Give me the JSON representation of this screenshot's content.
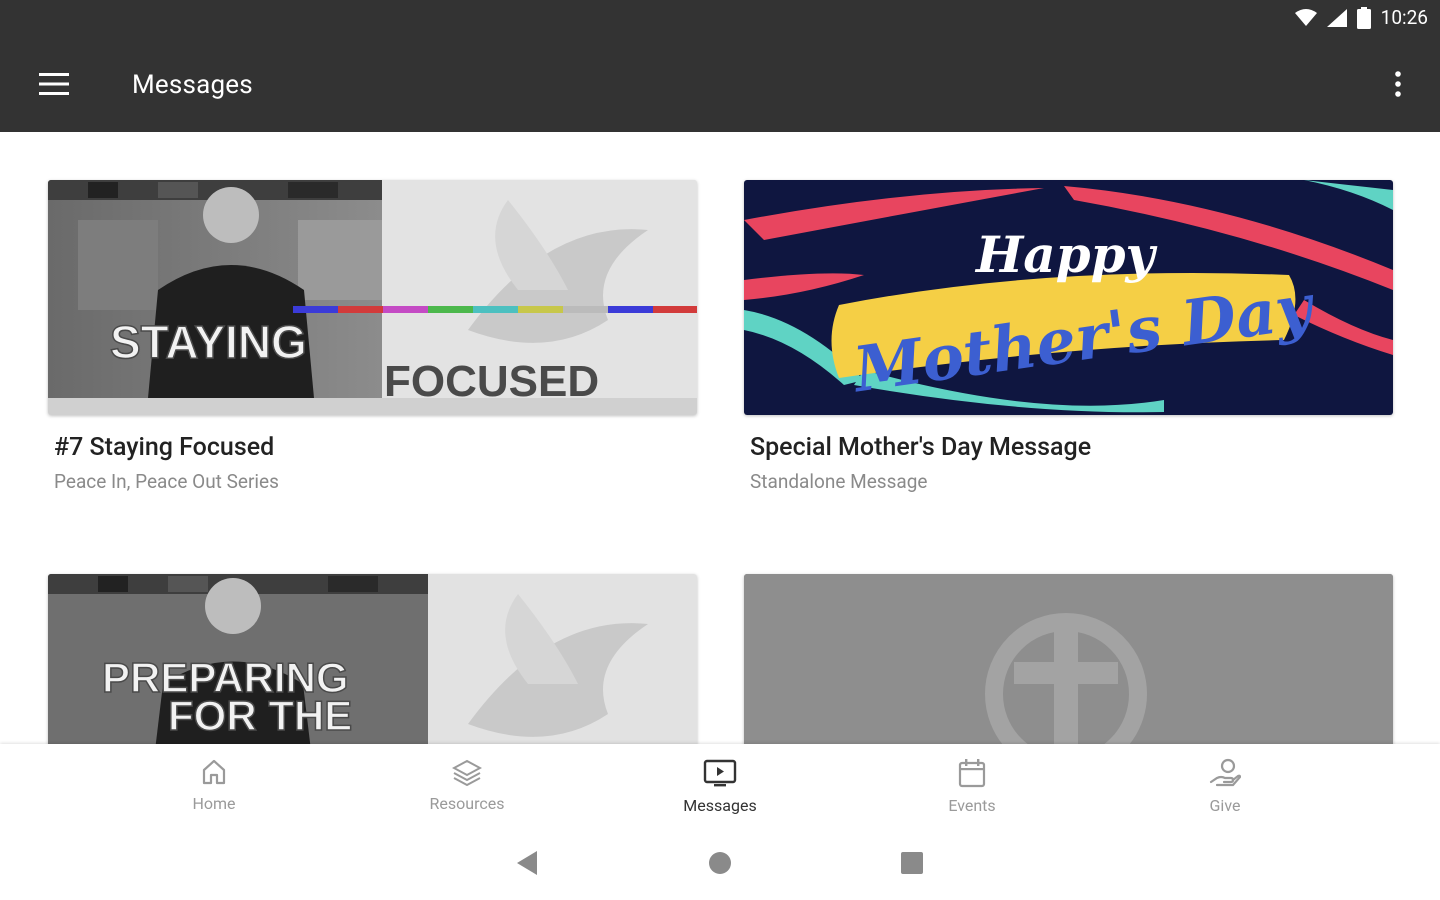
{
  "status": {
    "time": "10:26"
  },
  "appbar": {
    "title": "Messages"
  },
  "cards": [
    {
      "title": "#7 Staying Focused",
      "subtitle": "Peace In, Peace Out Series",
      "art_line1": "STAYING",
      "art_line2": "FOCUSED"
    },
    {
      "title": "Special Mother's Day Message",
      "subtitle": "Standalone Message",
      "art_line1": "Happy",
      "art_line2": "Mother's Day"
    },
    {
      "art_line1": "PREPARING",
      "art_line2": "FOR THE"
    },
    {}
  ],
  "nav": [
    {
      "label": "Home",
      "icon": "home-icon"
    },
    {
      "label": "Resources",
      "icon": "layers-icon"
    },
    {
      "label": "Messages",
      "icon": "tv-icon",
      "active": true
    },
    {
      "label": "Events",
      "icon": "calendar-icon"
    },
    {
      "label": "Give",
      "icon": "give-icon"
    }
  ],
  "colors": {
    "appbar": "#333333",
    "active_nav": "#333333",
    "inactive_nav": "#9a9a9a",
    "mothers_bg": "#0f1640",
    "mothers_yellow": "#f5cf45",
    "mothers_blue": "#3c5fd1",
    "mothers_pink": "#e8455f"
  }
}
